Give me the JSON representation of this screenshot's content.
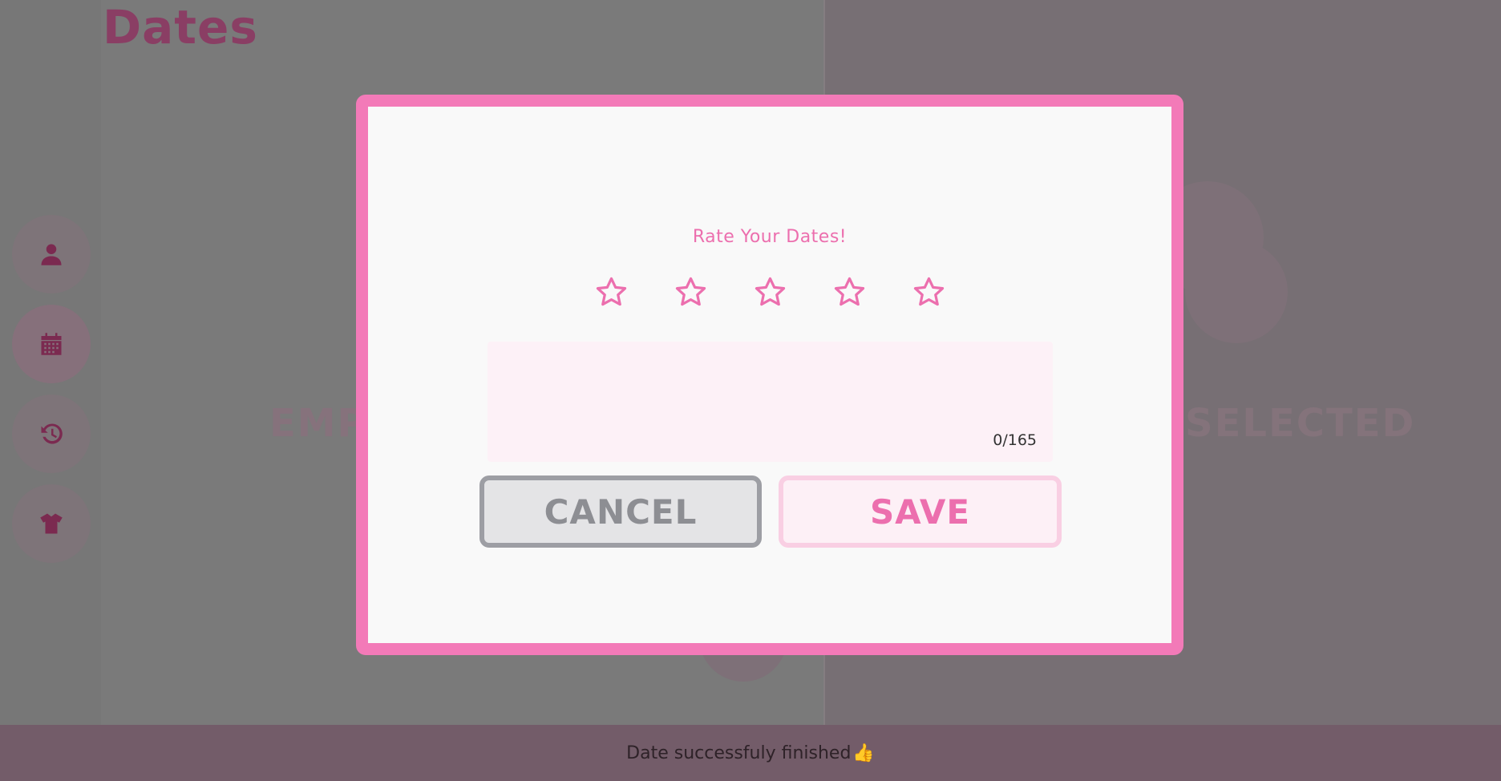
{
  "app": {
    "title": "Dates"
  },
  "sidebar": {
    "items": [
      {
        "name": "profile",
        "icon": "user-icon"
      },
      {
        "name": "dates",
        "icon": "calendar-icon",
        "active": true
      },
      {
        "name": "history",
        "icon": "history-icon"
      },
      {
        "name": "outfits",
        "icon": "shirt-icon"
      }
    ]
  },
  "background": {
    "left_label": "EMP",
    "right_label": "SELECTED"
  },
  "modal": {
    "title": "Rate Your Dates!",
    "rating": {
      "value": 0,
      "max": 5,
      "icon": "star-outline-icon"
    },
    "review": {
      "value": "",
      "counter": "0/165"
    },
    "cancel_label": "CANCEL",
    "save_label": "SAVE"
  },
  "status": {
    "message": "Date successfuly finished",
    "emoji": "👍"
  },
  "colors": {
    "accent": "#f37ab8",
    "accent_text": "#ec6fae",
    "overlay_bg": "#7a7a7a",
    "status_bar": "#735c69"
  }
}
